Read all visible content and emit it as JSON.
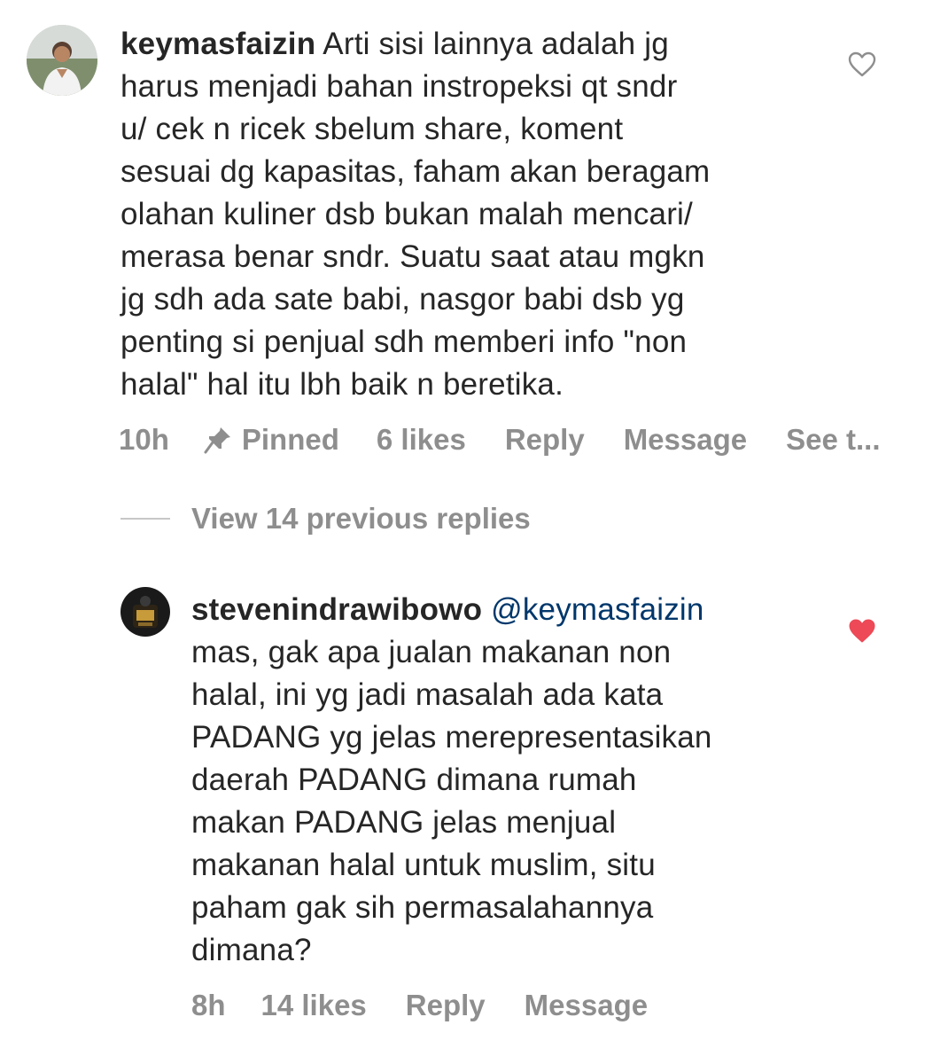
{
  "comments": [
    {
      "username": "keymasfaizin",
      "mention": "",
      "lines": [
        "Arti sisi lainnya adalah jg",
        "harus menjadi bahan instropeksi qt sndr",
        "u/ cek n ricek sbelum share, koment",
        "sesuai dg kapasitas, faham akan beragam",
        "olahan kuliner dsb bukan malah mencari/",
        "merasa benar sndr. Suatu saat atau mgkn",
        "jg sdh ada sate babi, nasgor babi dsb yg",
        "penting si penjual sdh memberi info \"non",
        "halal\" hal itu lbh baik n beretika."
      ],
      "time": "10h",
      "pinned_label": "Pinned",
      "likes": "6 likes",
      "reply_label": "Reply",
      "message_label": "Message",
      "see_translation_label": "See t...",
      "liked": false,
      "icon": "heart-outline-icon"
    },
    {
      "username": "stevenindrawibowo",
      "mention": "@keymasfaizin",
      "lines": [
        "mas, gak apa jualan makanan non",
        "halal, ini yg jadi masalah ada kata",
        "PADANG yg jelas merepresentasikan",
        "daerah PADANG dimana rumah",
        "makan PADANG jelas menjual",
        "makanan halal untuk muslim, situ",
        "paham gak sih permasalahannya",
        "dimana?"
      ],
      "time": "8h",
      "likes": "14 likes",
      "reply_label": "Reply",
      "message_label": "Message",
      "liked": true,
      "icon": "heart-filled-icon"
    }
  ],
  "view_replies": {
    "label": "View 14 previous replies"
  },
  "colors": {
    "text": "#262626",
    "meta": "#8e8e8e",
    "mention": "#00376b",
    "liked_heart": "#ed4956"
  }
}
